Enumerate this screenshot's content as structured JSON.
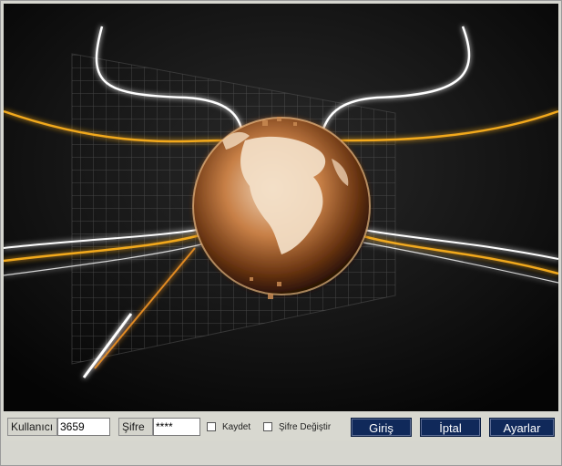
{
  "login": {
    "username_label": "Kullanıcı",
    "username_value": "3659",
    "password_label": "Şifre",
    "password_value": "****",
    "remember_label": "Kaydet",
    "change_password_label": "Şifre Değiştir"
  },
  "buttons": {
    "login": "Giriş",
    "cancel": "İptal",
    "settings": "Ayarlar"
  },
  "splash": {
    "image": "glowing-globe-grid-illustration"
  },
  "colors": {
    "button_bg": "#10295a",
    "panel_bg": "#d6d6cf",
    "splash_bg": "#0b0b0b",
    "accent_gold": "#f2a91f"
  }
}
